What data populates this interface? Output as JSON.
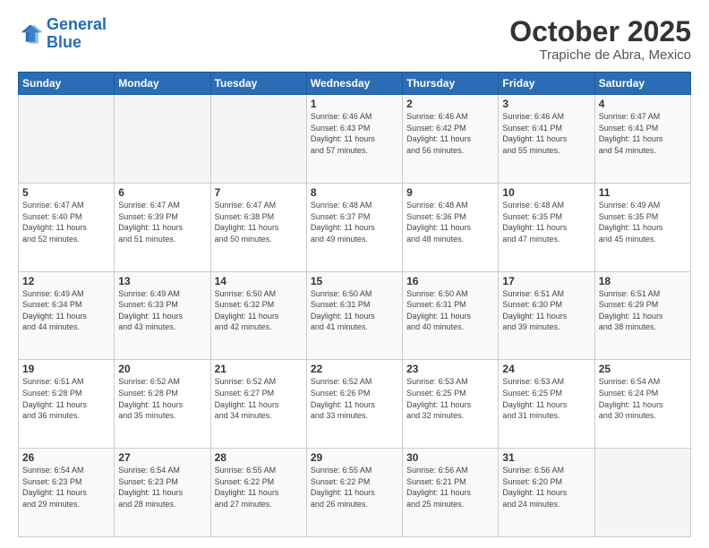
{
  "header": {
    "logo_line1": "General",
    "logo_line2": "Blue",
    "month": "October 2025",
    "location": "Trapiche de Abra, Mexico"
  },
  "weekdays": [
    "Sunday",
    "Monday",
    "Tuesday",
    "Wednesday",
    "Thursday",
    "Friday",
    "Saturday"
  ],
  "weeks": [
    [
      {
        "day": "",
        "info": ""
      },
      {
        "day": "",
        "info": ""
      },
      {
        "day": "",
        "info": ""
      },
      {
        "day": "1",
        "info": "Sunrise: 6:46 AM\nSunset: 6:43 PM\nDaylight: 11 hours\nand 57 minutes."
      },
      {
        "day": "2",
        "info": "Sunrise: 6:46 AM\nSunset: 6:42 PM\nDaylight: 11 hours\nand 56 minutes."
      },
      {
        "day": "3",
        "info": "Sunrise: 6:46 AM\nSunset: 6:41 PM\nDaylight: 11 hours\nand 55 minutes."
      },
      {
        "day": "4",
        "info": "Sunrise: 6:47 AM\nSunset: 6:41 PM\nDaylight: 11 hours\nand 54 minutes."
      }
    ],
    [
      {
        "day": "5",
        "info": "Sunrise: 6:47 AM\nSunset: 6:40 PM\nDaylight: 11 hours\nand 52 minutes."
      },
      {
        "day": "6",
        "info": "Sunrise: 6:47 AM\nSunset: 6:39 PM\nDaylight: 11 hours\nand 51 minutes."
      },
      {
        "day": "7",
        "info": "Sunrise: 6:47 AM\nSunset: 6:38 PM\nDaylight: 11 hours\nand 50 minutes."
      },
      {
        "day": "8",
        "info": "Sunrise: 6:48 AM\nSunset: 6:37 PM\nDaylight: 11 hours\nand 49 minutes."
      },
      {
        "day": "9",
        "info": "Sunrise: 6:48 AM\nSunset: 6:36 PM\nDaylight: 11 hours\nand 48 minutes."
      },
      {
        "day": "10",
        "info": "Sunrise: 6:48 AM\nSunset: 6:35 PM\nDaylight: 11 hours\nand 47 minutes."
      },
      {
        "day": "11",
        "info": "Sunrise: 6:49 AM\nSunset: 6:35 PM\nDaylight: 11 hours\nand 45 minutes."
      }
    ],
    [
      {
        "day": "12",
        "info": "Sunrise: 6:49 AM\nSunset: 6:34 PM\nDaylight: 11 hours\nand 44 minutes."
      },
      {
        "day": "13",
        "info": "Sunrise: 6:49 AM\nSunset: 6:33 PM\nDaylight: 11 hours\nand 43 minutes."
      },
      {
        "day": "14",
        "info": "Sunrise: 6:50 AM\nSunset: 6:32 PM\nDaylight: 11 hours\nand 42 minutes."
      },
      {
        "day": "15",
        "info": "Sunrise: 6:50 AM\nSunset: 6:31 PM\nDaylight: 11 hours\nand 41 minutes."
      },
      {
        "day": "16",
        "info": "Sunrise: 6:50 AM\nSunset: 6:31 PM\nDaylight: 11 hours\nand 40 minutes."
      },
      {
        "day": "17",
        "info": "Sunrise: 6:51 AM\nSunset: 6:30 PM\nDaylight: 11 hours\nand 39 minutes."
      },
      {
        "day": "18",
        "info": "Sunrise: 6:51 AM\nSunset: 6:29 PM\nDaylight: 11 hours\nand 38 minutes."
      }
    ],
    [
      {
        "day": "19",
        "info": "Sunrise: 6:51 AM\nSunset: 6:28 PM\nDaylight: 11 hours\nand 36 minutes."
      },
      {
        "day": "20",
        "info": "Sunrise: 6:52 AM\nSunset: 6:28 PM\nDaylight: 11 hours\nand 35 minutes."
      },
      {
        "day": "21",
        "info": "Sunrise: 6:52 AM\nSunset: 6:27 PM\nDaylight: 11 hours\nand 34 minutes."
      },
      {
        "day": "22",
        "info": "Sunrise: 6:52 AM\nSunset: 6:26 PM\nDaylight: 11 hours\nand 33 minutes."
      },
      {
        "day": "23",
        "info": "Sunrise: 6:53 AM\nSunset: 6:25 PM\nDaylight: 11 hours\nand 32 minutes."
      },
      {
        "day": "24",
        "info": "Sunrise: 6:53 AM\nSunset: 6:25 PM\nDaylight: 11 hours\nand 31 minutes."
      },
      {
        "day": "25",
        "info": "Sunrise: 6:54 AM\nSunset: 6:24 PM\nDaylight: 11 hours\nand 30 minutes."
      }
    ],
    [
      {
        "day": "26",
        "info": "Sunrise: 6:54 AM\nSunset: 6:23 PM\nDaylight: 11 hours\nand 29 minutes."
      },
      {
        "day": "27",
        "info": "Sunrise: 6:54 AM\nSunset: 6:23 PM\nDaylight: 11 hours\nand 28 minutes."
      },
      {
        "day": "28",
        "info": "Sunrise: 6:55 AM\nSunset: 6:22 PM\nDaylight: 11 hours\nand 27 minutes."
      },
      {
        "day": "29",
        "info": "Sunrise: 6:55 AM\nSunset: 6:22 PM\nDaylight: 11 hours\nand 26 minutes."
      },
      {
        "day": "30",
        "info": "Sunrise: 6:56 AM\nSunset: 6:21 PM\nDaylight: 11 hours\nand 25 minutes."
      },
      {
        "day": "31",
        "info": "Sunrise: 6:56 AM\nSunset: 6:20 PM\nDaylight: 11 hours\nand 24 minutes."
      },
      {
        "day": "",
        "info": ""
      }
    ]
  ]
}
